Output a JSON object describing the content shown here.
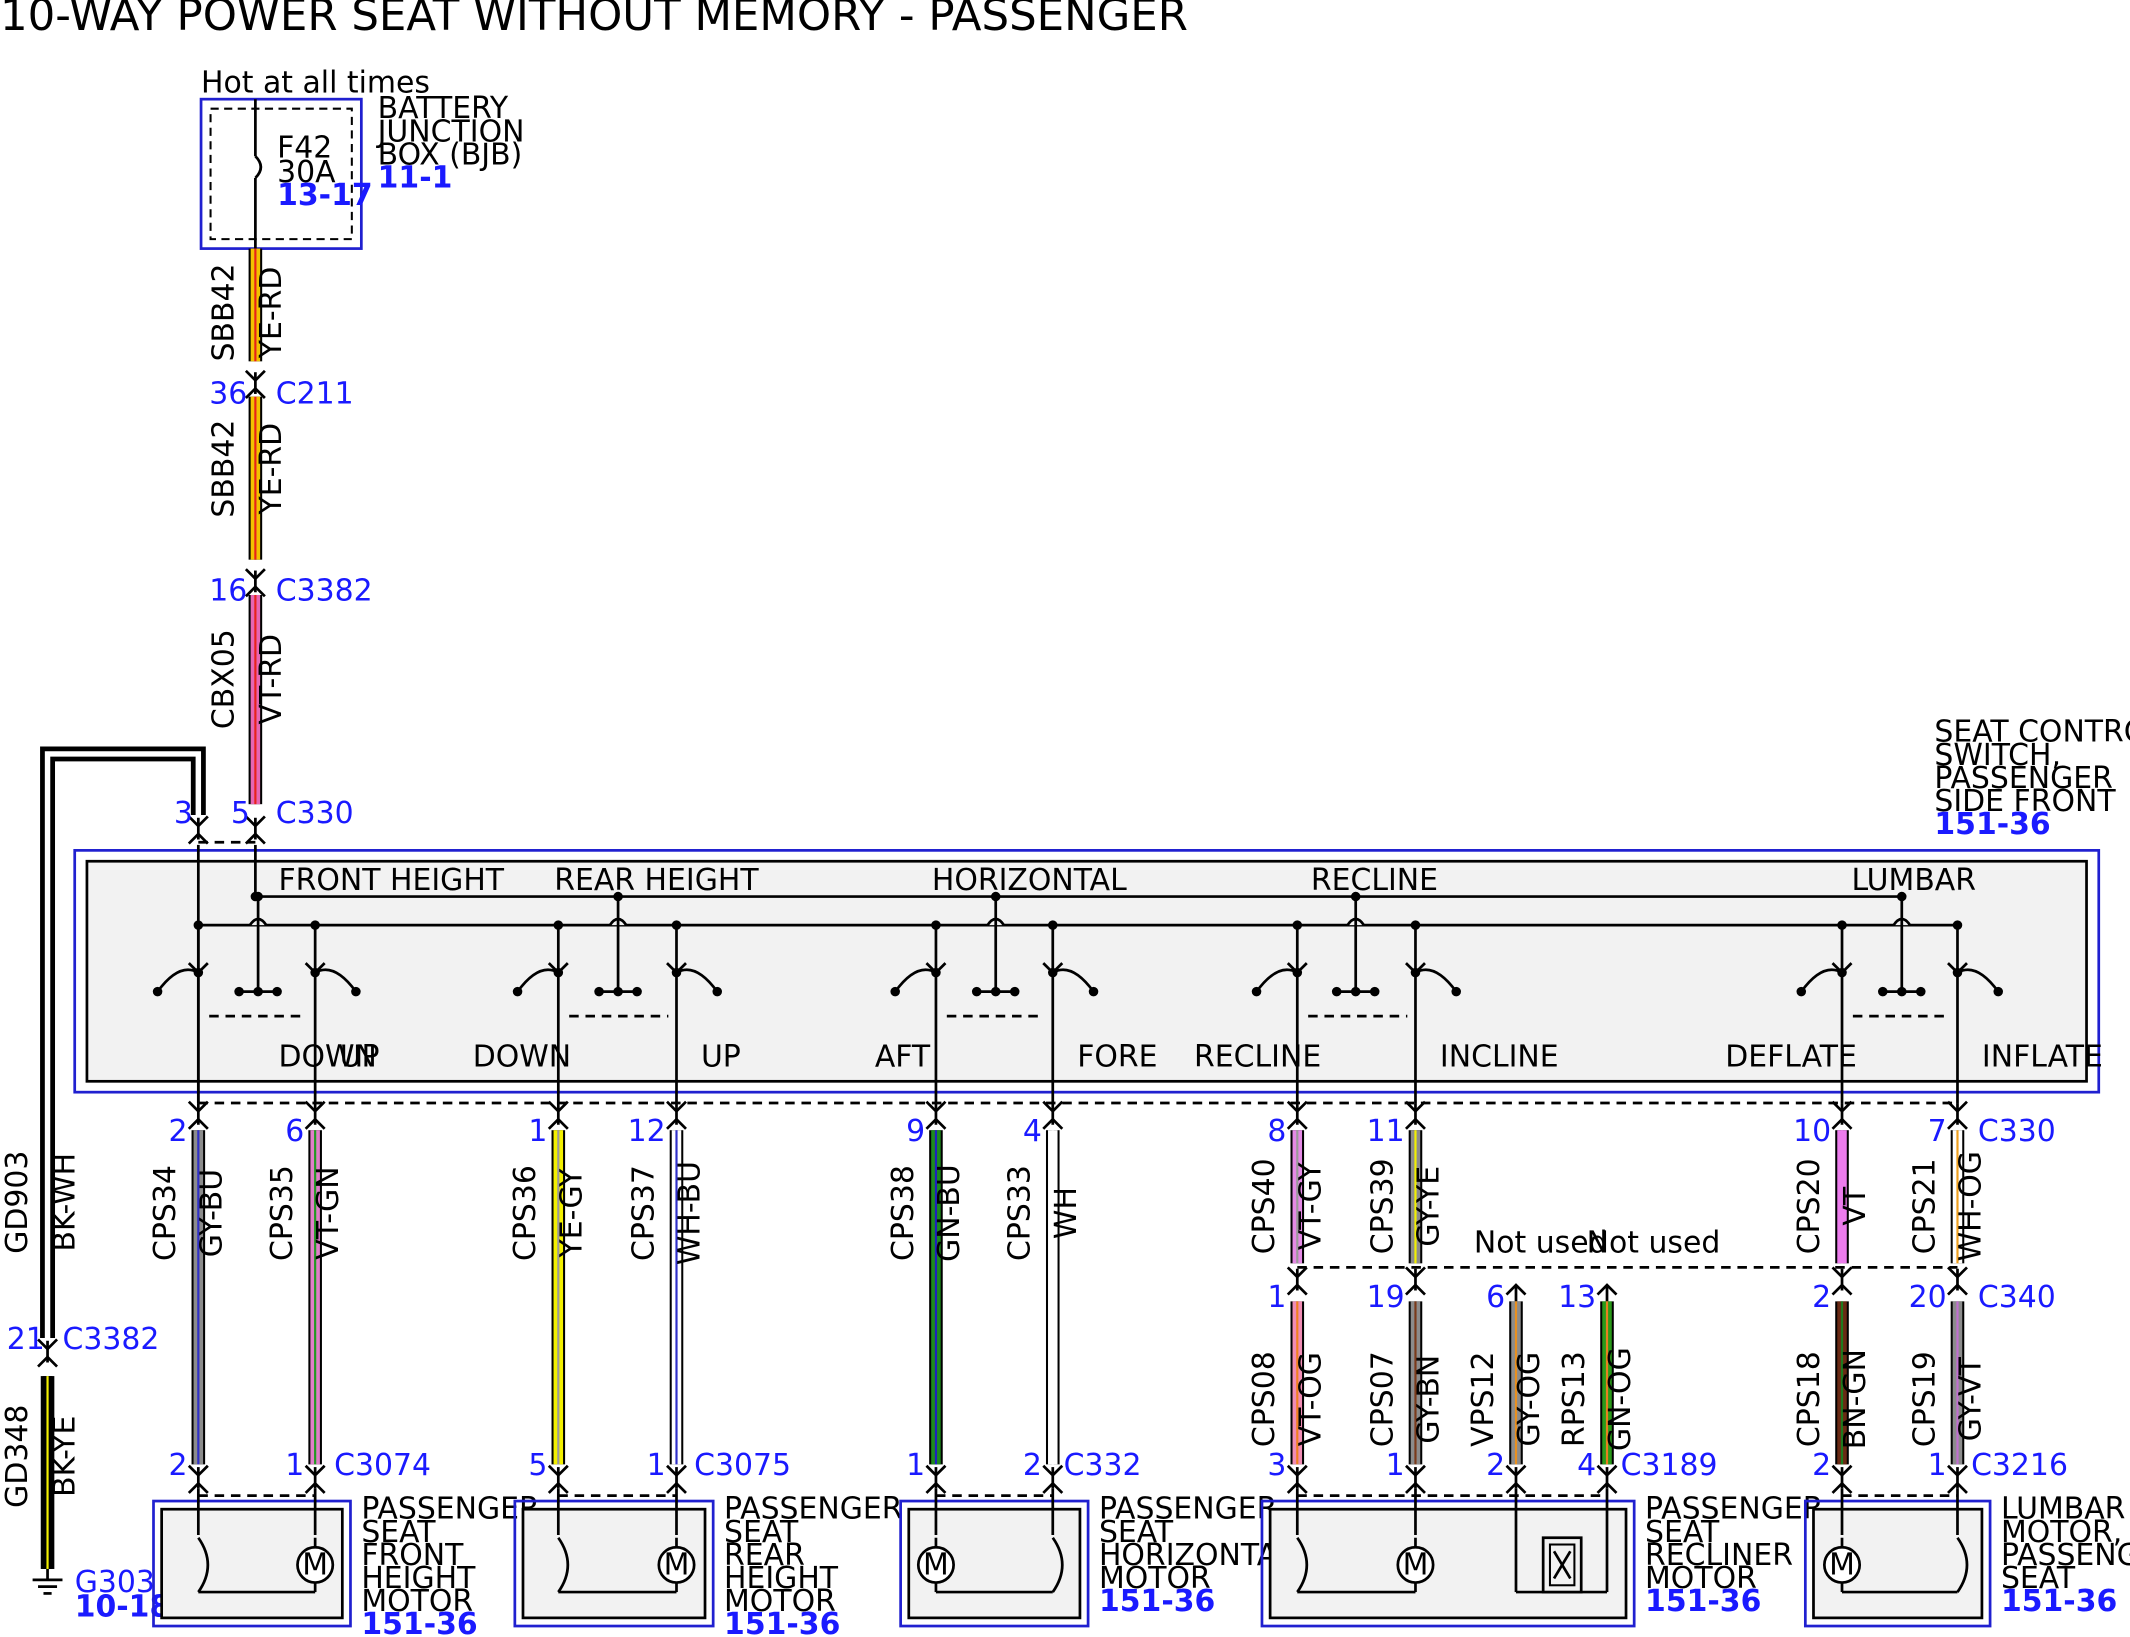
{
  "title": "10-WAY POWER SEAT WITHOUT MEMORY - PASSENGER",
  "colors": {
    "YE-RD": [
      "#f2c200",
      "#e8221a"
    ],
    "VT-RD": [
      "#e666b4",
      "#e8221a"
    ],
    "BK-WH": [
      "#000000",
      "#ffffff"
    ],
    "BK-YE": [
      "#000000",
      "#f3f000"
    ],
    "GY-BU": [
      "#8c8c8c",
      "#3030c8"
    ],
    "VT-GN": [
      "#e080c8",
      "#229922"
    ],
    "YE-GY": [
      "#f3f000",
      "#9a9a9a"
    ],
    "WH-BU": [
      "#ffffff",
      "#3030c8"
    ],
    "GN-BU": [
      "#1e8a1e",
      "#2020c0"
    ],
    "WH": [
      "#ffffff",
      "#ffffff"
    ],
    "VT-GY": [
      "#e58ae6",
      "#9a9a9a"
    ],
    "GY-YE": [
      "#8c8c8c",
      "#f3f000"
    ],
    "VT": [
      "#ec7cec",
      "#ec7cec"
    ],
    "WH-OG": [
      "#ffffff",
      "#f0a020"
    ],
    "VT-OG": [
      "#f08cb4",
      "#f08020"
    ],
    "GY-BN": [
      "#8c8c8c",
      "#7a3a1a"
    ],
    "GY-OG": [
      "#8c8c8c",
      "#e89020"
    ],
    "GN-OG": [
      "#2a9a1a",
      "#e88020"
    ],
    "BN-GN": [
      "#6a2a14",
      "#1e7a1e"
    ],
    "GY-VT": [
      "#8c8c8c",
      "#c070d0"
    ]
  },
  "bjb": {
    "hot_label": "Hot at all times",
    "fuse_id": "F42",
    "fuse_rating": "30A",
    "fuse_ref": "13-17",
    "name_lines": [
      "BATTERY",
      "JUNCTION",
      "BOX (BJB)"
    ],
    "ref": "11-1"
  },
  "feed_wires": [
    {
      "circuit": "SBB42",
      "color": "YE-RD"
    },
    {
      "circuit": "SBB42",
      "color": "YE-RD"
    },
    {
      "circuit": "CBX05",
      "color": "VT-RD"
    }
  ],
  "feed_connectors": [
    {
      "pin": "36",
      "connector": "C211"
    },
    {
      "pin": "16",
      "connector": "C3382"
    },
    {
      "pin": "5",
      "connector": "C330"
    }
  ],
  "switch": {
    "name_lines": [
      "SEAT CONTROL",
      "SWITCH,",
      "PASSENGER",
      "SIDE FRONT"
    ],
    "ref": "151-36",
    "ground_pin": "3",
    "sections": [
      {
        "name": "FRONT HEIGHT",
        "left": "DOWN",
        "right": "UP"
      },
      {
        "name": "REAR HEIGHT",
        "left": "DOWN",
        "right": "UP"
      },
      {
        "name": "HORIZONTAL",
        "left": "AFT",
        "right": "FORE"
      },
      {
        "name": "RECLINE",
        "left": "RECLINE",
        "right": "INCLINE"
      },
      {
        "name": "LUMBAR",
        "left": "DEFLATE",
        "right": "INFLATE"
      }
    ]
  },
  "ground": {
    "upper_circuit": "GD903",
    "upper_color": "BK-WH",
    "pin": "21",
    "connector": "C3382",
    "lower_circuit": "GD348",
    "lower_color": "BK-YE",
    "ground_id": "G303",
    "ground_ref": "10-18"
  },
  "c330_label": "C330",
  "c340_label": "C340",
  "not_used_label": "Not used",
  "switch_outputs": [
    {
      "pin": "2",
      "circuit": "CPS34",
      "color": "GY-BU"
    },
    {
      "pin": "6",
      "circuit": "CPS35",
      "color": "VT-GN"
    },
    {
      "pin": "1",
      "circuit": "CPS36",
      "color": "YE-GY"
    },
    {
      "pin": "12",
      "circuit": "CPS37",
      "color": "WH-BU"
    },
    {
      "pin": "9",
      "circuit": "CPS38",
      "color": "GN-BU"
    },
    {
      "pin": "4",
      "circuit": "CPS33",
      "color": "WH"
    },
    {
      "pin": "8",
      "circuit": "CPS40",
      "color": "VT-GY"
    },
    {
      "pin": "11",
      "circuit": "CPS39",
      "color": "GY-YE"
    },
    {
      "pin": "10",
      "circuit": "CPS20",
      "color": "VT"
    },
    {
      "pin": "7",
      "circuit": "CPS21",
      "color": "WH-OG"
    }
  ],
  "c340_wires": [
    {
      "pin_top": "1",
      "circuit": "CPS08",
      "color": "VT-OG",
      "pin_bottom": "3"
    },
    {
      "pin_top": "19",
      "circuit": "CPS07",
      "color": "GY-BN",
      "pin_bottom": "1"
    },
    {
      "pin_top": "6",
      "circuit": "VPS12",
      "color": "GY-OG",
      "pin_bottom": "2"
    },
    {
      "pin_top": "13",
      "circuit": "RPS13",
      "color": "GN-OG",
      "pin_bottom": "4"
    },
    {
      "pin_top": "2",
      "circuit": "CPS18",
      "color": "BN-GN",
      "pin_bottom": "2"
    },
    {
      "pin_top": "20",
      "circuit": "CPS19",
      "color": "GY-VT",
      "pin_bottom": "1"
    }
  ],
  "motors": [
    {
      "name_lines": [
        "PASSENGER",
        "SEAT",
        "FRONT",
        "HEIGHT",
        "MOTOR"
      ],
      "ref": "151-36",
      "connector": "C3074",
      "pins": [
        "2",
        "1"
      ]
    },
    {
      "name_lines": [
        "PASSENGER",
        "SEAT",
        "REAR",
        "HEIGHT",
        "MOTOR"
      ],
      "ref": "151-36",
      "connector": "C3075",
      "pins": [
        "5",
        "1"
      ]
    },
    {
      "name_lines": [
        "PASSENGER",
        "SEAT",
        "HORIZONTAL",
        "MOTOR"
      ],
      "ref": "151-36",
      "connector": "C332",
      "pins": [
        "1",
        "2"
      ]
    },
    {
      "name_lines": [
        "PASSENGER",
        "SEAT",
        "RECLINER",
        "MOTOR"
      ],
      "ref": "151-36",
      "connector": "C3189",
      "pins": [
        "3",
        "1",
        "2",
        "4"
      ]
    },
    {
      "name_lines": [
        "LUMBAR",
        "MOTOR,",
        "PASSENGER",
        "SEAT"
      ],
      "ref": "151-36",
      "connector": "C3216",
      "pins": [
        "2",
        "1"
      ]
    }
  ]
}
